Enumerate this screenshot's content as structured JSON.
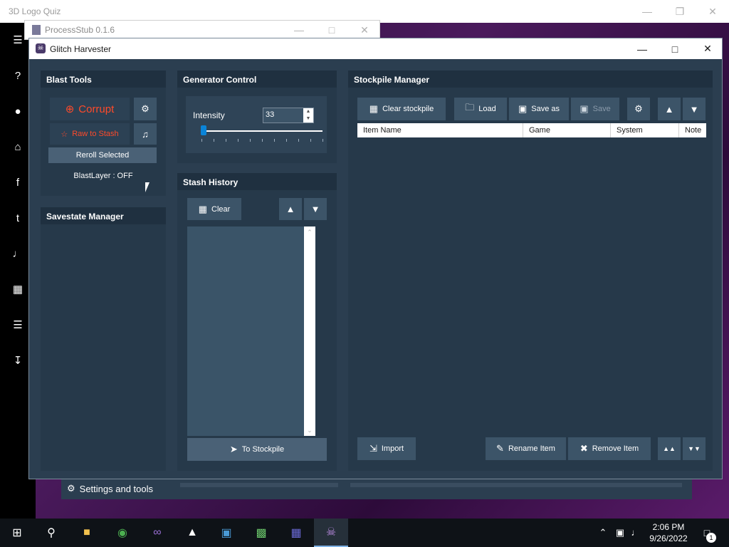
{
  "background_app": {
    "title": "3D Logo Quiz",
    "sidebar_icons": [
      "menu-icon",
      "help-icon",
      "globe-icon",
      "home-icon",
      "facebook-icon",
      "twitter-icon",
      "volume-icon",
      "trash-icon",
      "list-icon",
      "download-icon"
    ]
  },
  "process_stub": {
    "title": "ProcessStub 0.1.6"
  },
  "glitch_harvester": {
    "title": "Glitch Harvester",
    "blast_tools": {
      "header": "Blast Tools",
      "corrupt_label": "Corrupt",
      "raw_to_stash_label": "Raw to Stash",
      "reroll_label": "Reroll Selected",
      "blastlayer_status": "BlastLayer : OFF",
      "accent_color": "#ff4a2a"
    },
    "savestate_manager": {
      "header": "Savestate Manager"
    },
    "generator_control": {
      "header": "Generator Control",
      "intensity_label": "Intensity",
      "intensity_value": "33",
      "slider_fraction": 0.02
    },
    "stash_history": {
      "header": "Stash History",
      "clear_label": "Clear",
      "to_stockpile_label": "To Stockpile"
    },
    "stockpile_manager": {
      "header": "Stockpile Manager",
      "clear_label": "Clear stockpile",
      "load_label": "Load",
      "save_as_label": "Save as",
      "save_label": "Save",
      "columns": [
        "Item Name",
        "Game",
        "System",
        "Note"
      ],
      "import_label": "Import",
      "rename_label": "Rename Item",
      "remove_label": "Remove Item"
    },
    "settings_label": "Settings and tools"
  },
  "taskbar": {
    "time": "2:06 PM",
    "date": "9/26/2022",
    "notification_count": "1"
  }
}
